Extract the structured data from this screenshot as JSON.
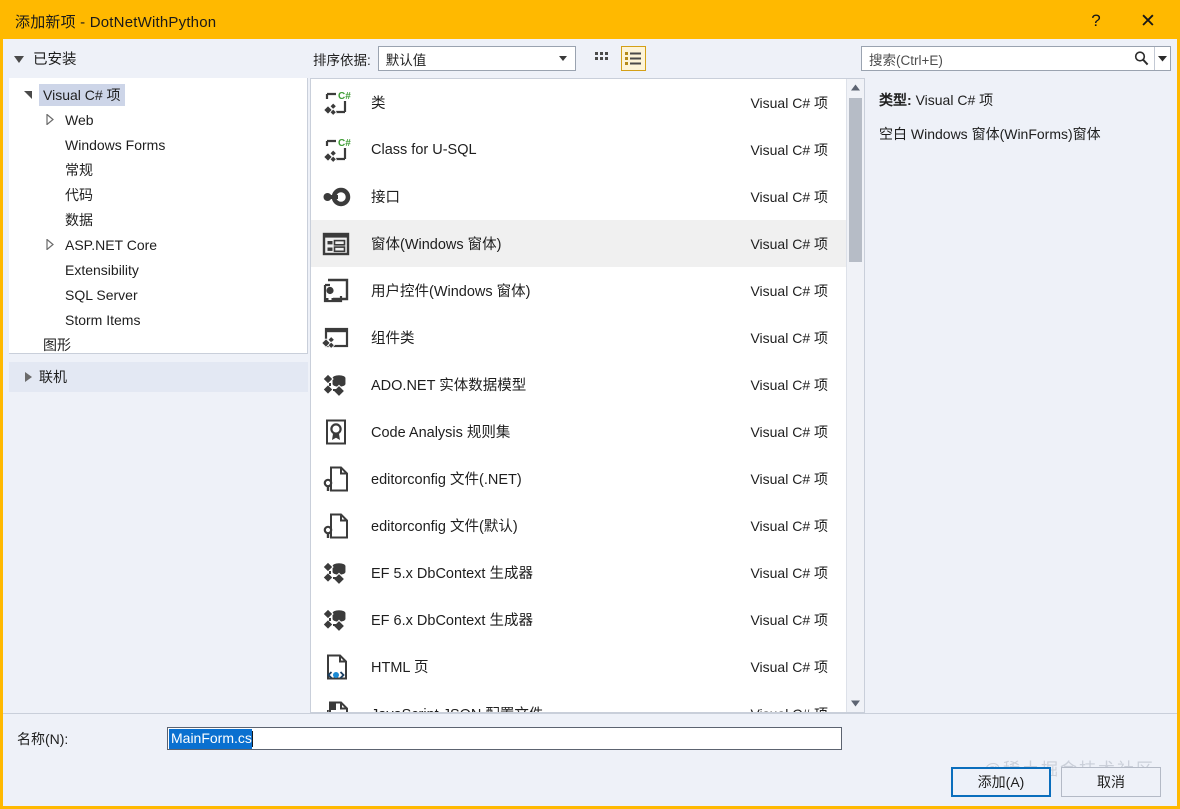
{
  "window": {
    "title": "添加新项 - DotNetWithPython",
    "help_label": "?",
    "close_label": "✕",
    "titlebar_color": "#ffb900"
  },
  "toolbar": {
    "installed_label": "已安装",
    "sort_label": "排序依据:",
    "sort_value": "默认值",
    "grid_view_icon": "grid-view-icon",
    "list_view_icon": "list-view-icon",
    "search_placeholder": "搜索(Ctrl+E)",
    "search_value": "",
    "search_icon": "search-icon",
    "search_dropdown_icon": "chevron-down-icon"
  },
  "sidebar": {
    "items": [
      {
        "label": "Visual C# 项",
        "level": 1,
        "expander": "expanded",
        "selected": true
      },
      {
        "label": "Web",
        "level": 2,
        "expander": "collapsed",
        "selected": false
      },
      {
        "label": "Windows Forms",
        "level": 2,
        "expander": "none",
        "selected": false
      },
      {
        "label": "常规",
        "level": 2,
        "expander": "none",
        "selected": false
      },
      {
        "label": "代码",
        "level": 2,
        "expander": "none",
        "selected": false
      },
      {
        "label": "数据",
        "level": 2,
        "expander": "none",
        "selected": false
      },
      {
        "label": "ASP.NET Core",
        "level": 2,
        "expander": "collapsed",
        "selected": false
      },
      {
        "label": "Extensibility",
        "level": 2,
        "expander": "none",
        "selected": false
      },
      {
        "label": "SQL Server",
        "level": 2,
        "expander": "none",
        "selected": false
      },
      {
        "label": "Storm Items",
        "level": 2,
        "expander": "none",
        "selected": false
      },
      {
        "label": "图形",
        "level": 1,
        "expander": "none",
        "selected": false
      }
    ],
    "online_label": "联机",
    "online_expander": "collapsed"
  },
  "templates": {
    "kind_label": "Visual C# 项",
    "items": [
      {
        "name": "类",
        "kind": "Visual C# 项",
        "icon": "csharp-class-icon",
        "selected": false
      },
      {
        "name": "Class for U-SQL",
        "kind": "Visual C# 项",
        "icon": "csharp-class-icon",
        "selected": false
      },
      {
        "name": "接口",
        "kind": "Visual C# 项",
        "icon": "interface-icon",
        "selected": false
      },
      {
        "name": "窗体(Windows 窗体)",
        "kind": "Visual C# 项",
        "icon": "windows-form-icon",
        "selected": true
      },
      {
        "name": "用户控件(Windows 窗体)",
        "kind": "Visual C# 项",
        "icon": "user-control-icon",
        "selected": false
      },
      {
        "name": "组件类",
        "kind": "Visual C# 项",
        "icon": "component-class-icon",
        "selected": false
      },
      {
        "name": "ADO.NET 实体数据模型",
        "kind": "Visual C# 项",
        "icon": "entity-data-model-icon",
        "selected": false
      },
      {
        "name": "Code Analysis 规则集",
        "kind": "Visual C# 项",
        "icon": "ruleset-icon",
        "selected": false
      },
      {
        "name": "editorconfig 文件(.NET)",
        "kind": "Visual C# 项",
        "icon": "editorconfig-icon",
        "selected": false
      },
      {
        "name": "editorconfig 文件(默认)",
        "kind": "Visual C# 项",
        "icon": "editorconfig-icon",
        "selected": false
      },
      {
        "name": "EF 5.x DbContext 生成器",
        "kind": "Visual C# 项",
        "icon": "entity-data-model-icon",
        "selected": false
      },
      {
        "name": "EF 6.x DbContext 生成器",
        "kind": "Visual C# 项",
        "icon": "entity-data-model-icon",
        "selected": false
      },
      {
        "name": "HTML 页",
        "kind": "Visual C# 项",
        "icon": "html-page-icon",
        "selected": false
      },
      {
        "name": "JavaScript JSON 配置文件",
        "kind": "Visual C# 项",
        "icon": "json-file-icon",
        "selected": false
      }
    ]
  },
  "details": {
    "type_label": "类型:",
    "type_value": "Visual C# 项",
    "description": "空白 Windows 窗体(WinForms)窗体"
  },
  "footer": {
    "name_label": "名称(N):",
    "name_value": "MainForm.cs",
    "add_label": "添加(A)",
    "cancel_label": "取消",
    "watermark": "@稀土掘金技术社区"
  }
}
